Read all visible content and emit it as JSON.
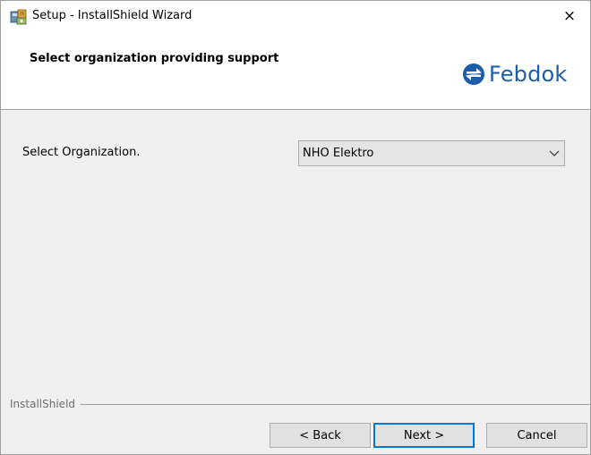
{
  "window": {
    "title": "Setup - InstallShield Wizard",
    "close_glyph": "×"
  },
  "banner": {
    "title": "Select organization providing support",
    "logo_text": "Febdok",
    "logo_color": "#1b5da8"
  },
  "form": {
    "label": "Select Organization.",
    "selected_value": "NHO Elektro"
  },
  "footer": {
    "brand": "InstallShield",
    "back_label": "< Back",
    "next_label": "Next >",
    "cancel_label": "Cancel",
    "focus_color": "#0078d7"
  },
  "icons": {
    "app": "installshield-setup-icon",
    "close": "close-icon",
    "dropdown": "chevron-down-icon",
    "logo": "febdok-logo-icon"
  }
}
